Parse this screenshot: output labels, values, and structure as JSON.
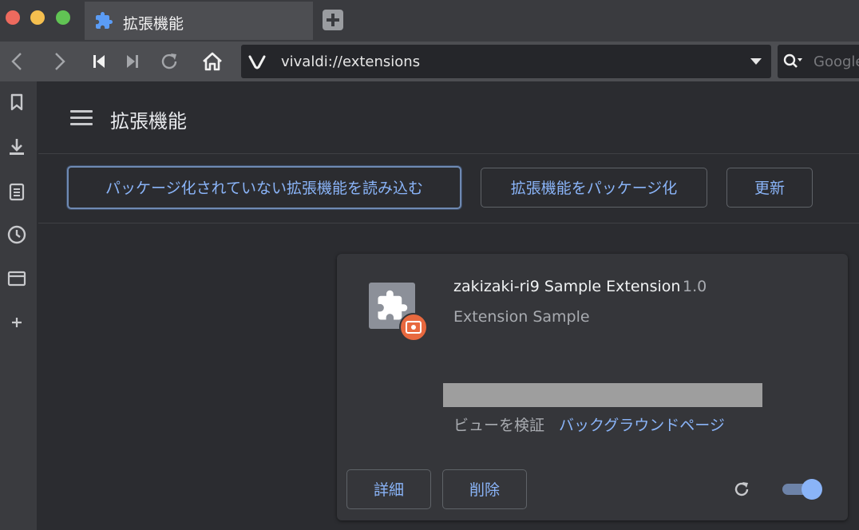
{
  "window": {
    "tab": {
      "title": "拡張機能",
      "icon": "puzzle-icon"
    }
  },
  "toolbar": {
    "address": "vivaldi://extensions",
    "search_placeholder": "Google"
  },
  "page": {
    "title": "拡張機能",
    "actions": {
      "load_unpacked": "パッケージ化されていない拡張機能を読み込む",
      "pack": "拡張機能をパッケージ化",
      "update": "更新"
    }
  },
  "extension": {
    "name": "zakizaki-ri9 Sample Extension",
    "version": "1.0",
    "description": "Extension Sample",
    "inspect_views_label": "ビューを検証",
    "inspect_views_link": "バックグラウンドページ",
    "details_label": "詳細",
    "remove_label": "削除",
    "enabled": true
  },
  "colors": {
    "accent": "#8ab4f8",
    "badge": "#e8693f"
  }
}
